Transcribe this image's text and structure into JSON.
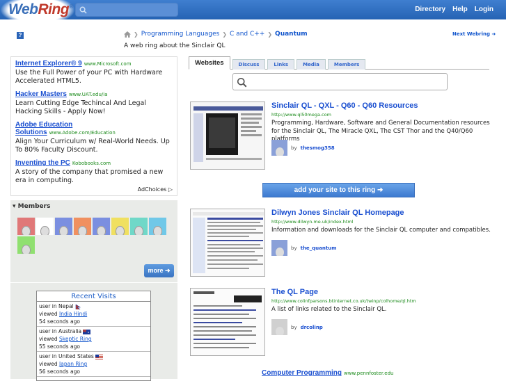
{
  "header": {
    "logo_text": "Web",
    "logo_ring": "Ring",
    "logo_mark": "®",
    "nav": [
      "Directory",
      "Help",
      "Login"
    ]
  },
  "help_glyph": "?",
  "breadcrumb": {
    "items": [
      "Programming Languages",
      "C and C++"
    ],
    "current": "Quantum",
    "sep": "❯"
  },
  "next_webring": "Next Webring ➜",
  "tagline": "A web ring about the Sinclair QL",
  "ads": [
    {
      "title": "Internet Explorer® 9",
      "url": "www.Microsoft.com",
      "desc": "Use the Full Power of your PC with Hardware Accelerated HTML5."
    },
    {
      "title": "Hacker Masters",
      "url": "www.UAT.edu/ia",
      "desc": "Learn Cutting Edge Techincal And Legal Hacking Skills - Apply Now!"
    },
    {
      "title": "Adobe Education Solutions",
      "url": "www.Adobe.com/Education",
      "desc": "Align Your Curriculum w/ Real-World Needs. Up To 80% Faculty Discount."
    },
    {
      "title": "Inventing the PC",
      "url": "Kobobooks.com",
      "desc": "A story of the company that promised a new era in computing."
    }
  ],
  "adchoices": "AdChoices ▷",
  "members": {
    "title": "▾ Members",
    "more_label": "more ➜",
    "avatar_colors": [
      "#e07878",
      "#ffffff",
      "#7b8fe0",
      "#f09060",
      "#7b8fe0",
      "#f0e060",
      "#70d8c8",
      "#70c8e8",
      "#90e070"
    ]
  },
  "recent": {
    "title": "Recent Visits",
    "visits": [
      {
        "line1": "user in Nepal",
        "viewed": "viewed",
        "link": "India Hindi",
        "ago": "54 seconds ago"
      },
      {
        "line1": "user in Australia",
        "viewed": "viewed",
        "link": "Skeptic Ring",
        "ago": "55 seconds ago"
      },
      {
        "line1": "user in United States",
        "viewed": "viewed",
        "link": "Japan Ring",
        "ago": "56 seconds ago"
      }
    ]
  },
  "tabs": [
    "Websites",
    "Discuss",
    "Links",
    "Media",
    "Members"
  ],
  "sites": [
    {
      "title": "Sinclair QL - QXL - Q60 - Q60 Resources",
      "url": "http://www.ql50mega.com",
      "desc": "Programming, Hardware, Software and General Documentation resources for the Sinclair QL, The Miracle QXL, The CST Thor and the Q40/Q60 platforms",
      "by": "by",
      "owner": "thesmog358",
      "owner_color": "#8aa0d8"
    },
    {
      "title": "Dilwyn Jones Sinclair QL Homepage",
      "url": "http://www.dilwyn.me.uk/index.html",
      "desc": "Information and downloads for the Sinclair QL computer and compatibles.",
      "by": "by",
      "owner": "the_quantum",
      "owner_color": "#8aa0d8"
    },
    {
      "title": "The QL Page",
      "url": "http://www.colinfparsons.btinternet.co.uk/twinp/colhome/ql.htm",
      "desc": "A list of links related to the Sinclair QL.",
      "by": "by",
      "owner": "drcolinp",
      "owner_color": "#d0d0d0"
    }
  ],
  "add_site_label": "add your site to this ring ➜",
  "bottom_ad": {
    "title": "Computer Programming",
    "url": "www.pennfoster.edu"
  }
}
